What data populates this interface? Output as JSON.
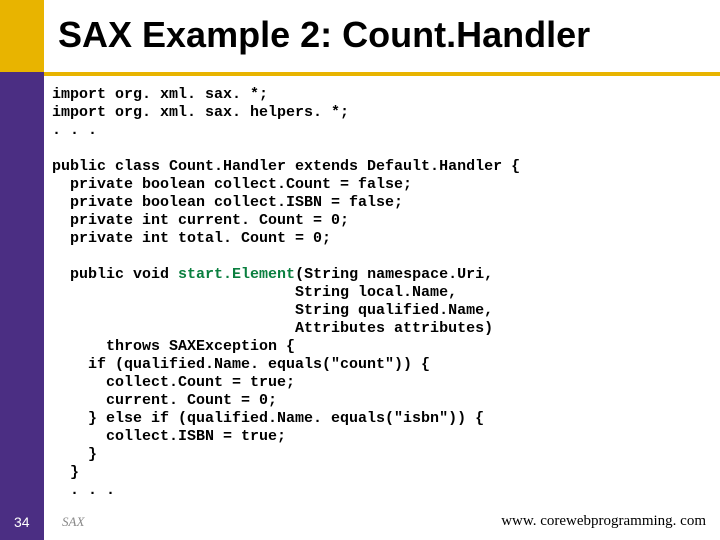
{
  "title": "SAX Example 2: Count.Handler",
  "slide_number": "34",
  "footer_left": "SAX",
  "footer_right": "www. corewebprogramming. com",
  "code": {
    "block1": "import org. xml. sax. *;\nimport org. xml. sax. helpers. *;\n. . .\n\npublic class Count.Handler extends Default.Handler {\n  private boolean collect.Count = false;\n  private boolean collect.ISBN = false;\n  private int current. Count = 0;\n  private int total. Count = 0;",
    "method_line": "  public void ",
    "method_name": "start.Element",
    "method_rest": "(String namespace.Uri,",
    "block2": "                           String local.Name,\n                           String qualified.Name,\n                           Attributes attributes)\n      throws SAXException {\n    if (qualified.Name. equals(\"count\")) {\n      collect.Count = true;\n      current. Count = 0;\n    } else if (qualified.Name. equals(\"isbn\")) {\n      collect.ISBN = true;\n    }\n  }\n  . . ."
  }
}
